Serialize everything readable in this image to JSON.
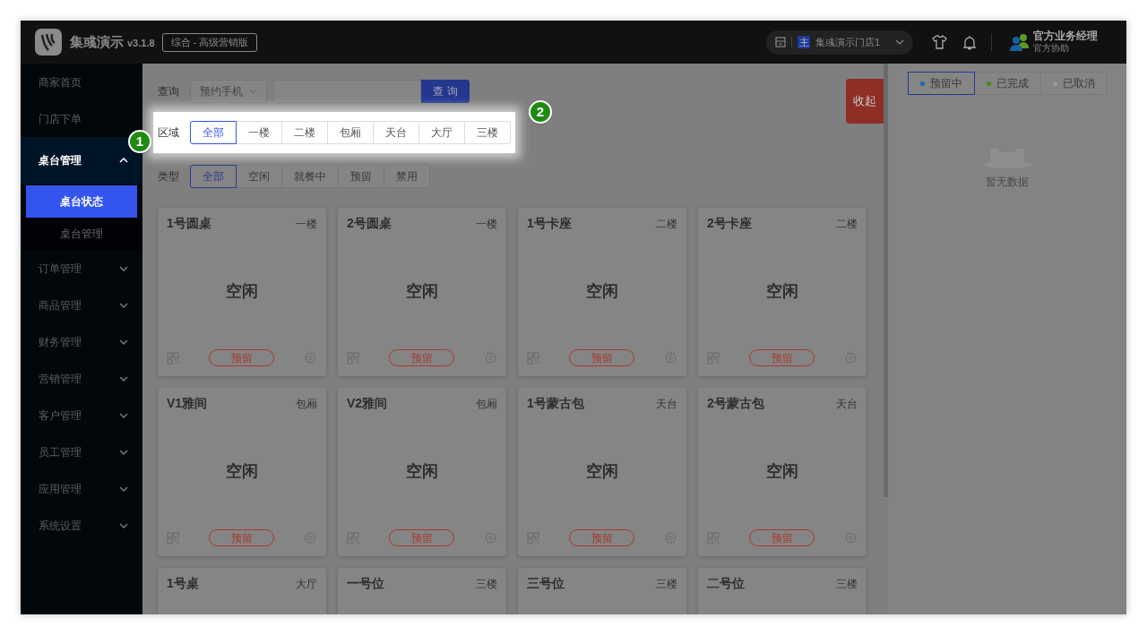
{
  "header": {
    "brand": "集彧演示",
    "version": "v3.1.8",
    "edition": "综合 - 高级营销版",
    "store": {
      "badge": "主",
      "name": "集彧演示门店1"
    },
    "user": {
      "name": "官方业务经理",
      "role": "官方协助"
    }
  },
  "sidebar": {
    "items": [
      {
        "label": "商家首页",
        "selected": false
      },
      {
        "label": "门店下单",
        "selected": false
      },
      {
        "label": "桌台管理",
        "selected": false,
        "expanded": true,
        "children": [
          {
            "label": "桌台状态",
            "selected": true
          },
          {
            "label": "桌台管理",
            "selected": false
          }
        ]
      },
      {
        "label": "订单管理",
        "selected": false,
        "expanded": false
      },
      {
        "label": "商品管理",
        "selected": false,
        "expanded": false
      },
      {
        "label": "财务管理",
        "selected": false,
        "expanded": false
      },
      {
        "label": "营销管理",
        "selected": false,
        "expanded": false
      },
      {
        "label": "客户管理",
        "selected": false,
        "expanded": false
      },
      {
        "label": "员工管理",
        "selected": false,
        "expanded": false
      },
      {
        "label": "应用管理",
        "selected": false,
        "expanded": false
      },
      {
        "label": "系统设置",
        "selected": false,
        "expanded": false
      }
    ]
  },
  "query": {
    "label": "查询",
    "select": "预约手机",
    "button": "查 询"
  },
  "area_filter": {
    "label": "区域",
    "options": [
      {
        "label": "全部",
        "selected": true
      },
      {
        "label": "一楼",
        "selected": false
      },
      {
        "label": "二楼",
        "selected": false
      },
      {
        "label": "包厢",
        "selected": false
      },
      {
        "label": "天台",
        "selected": false
      },
      {
        "label": "大厅",
        "selected": false
      },
      {
        "label": "三楼",
        "selected": false
      }
    ]
  },
  "type_filter": {
    "label": "类型",
    "options": [
      {
        "label": "全部",
        "selected": true
      },
      {
        "label": "空闲",
        "selected": false
      },
      {
        "label": "就餐中",
        "selected": false
      },
      {
        "label": "预留",
        "selected": false
      },
      {
        "label": "禁用",
        "selected": false
      }
    ]
  },
  "collapse_button": "收起",
  "tables": [
    {
      "name": "1号圆桌",
      "area": "一楼",
      "status": "空闲",
      "action": "预留"
    },
    {
      "name": "2号圆桌",
      "area": "一楼",
      "status": "空闲",
      "action": "预留"
    },
    {
      "name": "1号卡座",
      "area": "二楼",
      "status": "空闲",
      "action": "预留"
    },
    {
      "name": "2号卡座",
      "area": "二楼",
      "status": "空闲",
      "action": "预留"
    },
    {
      "name": "V1雅间",
      "area": "包厢",
      "status": "空闲",
      "action": "预留"
    },
    {
      "name": "V2雅间",
      "area": "包厢",
      "status": "空闲",
      "action": "预留"
    },
    {
      "name": "1号蒙古包",
      "area": "天台",
      "status": "空闲",
      "action": "预留"
    },
    {
      "name": "2号蒙古包",
      "area": "天台",
      "status": "空闲",
      "action": "预留"
    },
    {
      "name": "1号桌",
      "area": "大厅"
    },
    {
      "name": "一号位",
      "area": "三楼"
    },
    {
      "name": "三号位",
      "area": "三楼"
    },
    {
      "name": "二号位",
      "area": "三楼"
    }
  ],
  "reservations": {
    "tabs": [
      {
        "label": "预留中",
        "selected": true,
        "color": "#1565c0"
      },
      {
        "label": "已完成",
        "selected": false,
        "color": "#3d8b1a"
      },
      {
        "label": "已取消",
        "selected": false,
        "color": "#9a9a9a"
      }
    ],
    "empty_text": "暂无数据"
  },
  "guide_badges": [
    "1",
    "2"
  ]
}
